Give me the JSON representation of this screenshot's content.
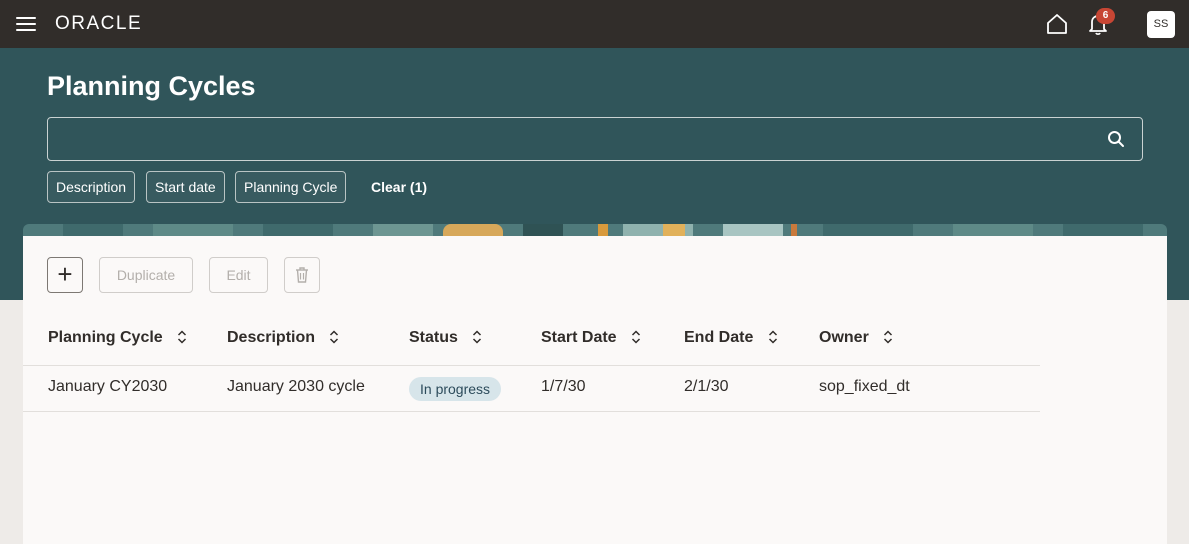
{
  "app": {
    "brand": "ORACLE",
    "notification_count": "6",
    "user_initials": "SS"
  },
  "page": {
    "title": "Planning Cycles"
  },
  "search": {
    "value": "",
    "placeholder": ""
  },
  "filters": {
    "chips": [
      "Description",
      "Start date",
      "Planning Cycle"
    ],
    "clear_label": "Clear (1)"
  },
  "toolbar": {
    "add_label": "+",
    "duplicate_label": "Duplicate",
    "edit_label": "Edit"
  },
  "table": {
    "columns": [
      "Planning Cycle",
      "Description",
      "Status",
      "Start Date",
      "End Date",
      "Owner"
    ],
    "rows": [
      {
        "planning_cycle": "January CY2030",
        "description": "January 2030 cycle",
        "status": "In progress",
        "start_date": "1/7/30",
        "end_date": "2/1/30",
        "owner": "sop_fixed_dt"
      }
    ]
  },
  "colors": {
    "topbar": "#312d2a",
    "header_band": "#30555a",
    "status_badge_bg": "#d7e5ea",
    "notification_badge": "#c74634"
  }
}
